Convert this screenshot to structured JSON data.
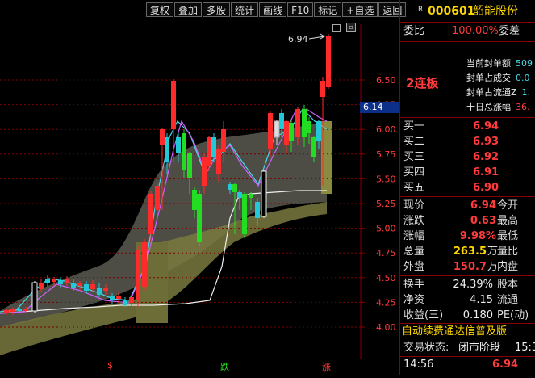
{
  "toolbar": {
    "buttons": [
      "复权",
      "叠加",
      "多股",
      "统计",
      "画线",
      "F10",
      "标记",
      "+自选",
      "返回"
    ],
    "icons": [
      "square-icon",
      "close-box-icon"
    ]
  },
  "chart": {
    "price_ticks": [
      "6.50",
      "6.25",
      "6.00",
      "5.75",
      "5.50",
      "5.25",
      "5.00",
      "4.75",
      "4.50",
      "4.25",
      "4.00"
    ],
    "current_price_tag": "6.14",
    "peak_label": "6.94",
    "annotation": "2连板",
    "info_lines": [
      "当前封单额",
      "封单占成交",
      "封单占流通Z",
      "十日总涨幅"
    ],
    "info_values": [
      "509",
      "0.0",
      "1.",
      "36."
    ],
    "bottom_markers": [
      {
        "text": "$",
        "color": "#ff3b3b"
      },
      {
        "text": "跌",
        "color": "#22dd22"
      },
      {
        "text": "涨",
        "color": "#ff3b3b"
      }
    ]
  },
  "panel": {
    "badge": "R",
    "stock_code": "000601",
    "stock_name": "韶能股份",
    "weibi_label": "委比",
    "weibi_value": "100.00%",
    "weicha_label": "委差",
    "bids": [
      {
        "label": "买一",
        "price": "6.94"
      },
      {
        "label": "买二",
        "price": "6.93"
      },
      {
        "label": "买三",
        "price": "6.92"
      },
      {
        "label": "买四",
        "price": "6.91"
      },
      {
        "label": "买五",
        "price": "6.90"
      }
    ],
    "quote": [
      {
        "label": "现价",
        "value": "6.94",
        "label2": "今开",
        "color": "red"
      },
      {
        "label": "涨跌",
        "value": "0.63",
        "label2": "最高",
        "color": "red"
      },
      {
        "label": "涨幅",
        "value": "9.98%",
        "label2": "最低",
        "color": "red"
      },
      {
        "label": "总量",
        "value": "263.5",
        "unit": "万",
        "label2": "量比",
        "color": "yellow"
      },
      {
        "label": "外盘",
        "value": "150.7",
        "unit": "万",
        "label2": "内盘",
        "color": "red"
      }
    ],
    "stats": [
      {
        "label": "换手",
        "value": "24.39%",
        "label2": "股本"
      },
      {
        "label": "净资",
        "value": "4.15",
        "label2": "流通"
      },
      {
        "label": "收益(三)",
        "value": "0.180",
        "label2": "PE(动)"
      }
    ],
    "concepts": "自动续费通达信普及版",
    "trade_status_label": "交易状态:",
    "trade_status": "闭市阶段",
    "trade_status_time": "15:3",
    "last_time": "14:56",
    "last_price": "6.94"
  }
}
